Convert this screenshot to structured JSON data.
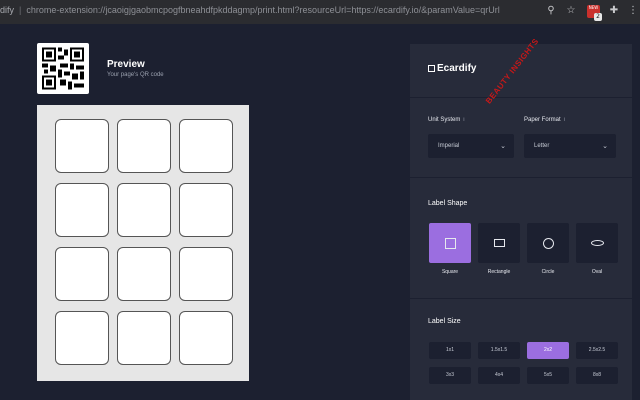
{
  "browser": {
    "url_prefix": "dify",
    "url": "chrome-extension://jcaoigjgaobmcpogfbneahdfpkddagmp/print.html?resourceUrl=https://ecardify.io/&paramValue=qrUrl",
    "ext_count": "2"
  },
  "preview": {
    "title": "Preview",
    "subtitle": "Your page's QR code"
  },
  "sheet": {
    "rows": 4,
    "cols": 3
  },
  "panel": {
    "brand": "Ecardify",
    "unit_system_label": "Unit System",
    "unit_system_info": "i",
    "unit_system_value": "Imperial",
    "paper_format_label": "Paper Format",
    "paper_format_info": "i",
    "paper_format_value": "Letter",
    "label_shape_title": "Label Shape",
    "shapes": [
      {
        "label": "Square",
        "active": true
      },
      {
        "label": "Rectangle",
        "active": false
      },
      {
        "label": "Circle",
        "active": false
      },
      {
        "label": "Oval",
        "active": false
      }
    ],
    "label_size_title": "Label Size",
    "sizes": [
      {
        "label": "1x1",
        "active": false
      },
      {
        "label": "1.5x1.5",
        "active": false
      },
      {
        "label": "2x2",
        "active": true
      },
      {
        "label": "2.5x2.5",
        "active": false
      },
      {
        "label": "3x3",
        "active": false
      },
      {
        "label": "4x4",
        "active": false
      },
      {
        "label": "5x5",
        "active": false
      },
      {
        "label": "8x8",
        "active": false
      }
    ]
  },
  "colors": {
    "accent": "#9b6ee0",
    "background": "#1c2030",
    "panel": "#272b3a"
  },
  "stamp": "BEAUTY INSIGHTS"
}
